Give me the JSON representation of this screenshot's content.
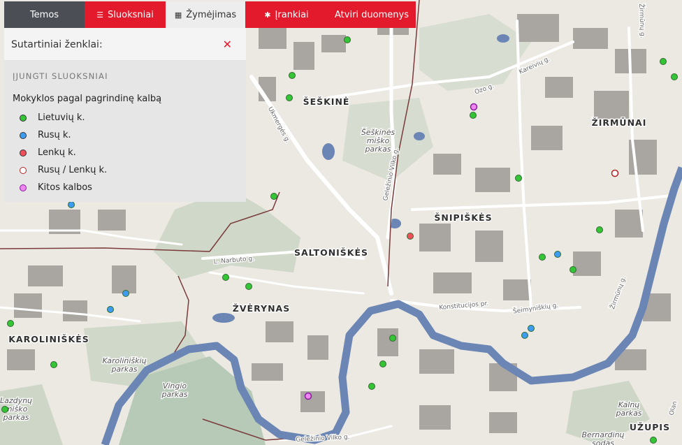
{
  "tabs": [
    {
      "label": "Temos",
      "icon": "",
      "active": false
    },
    {
      "label": "Sluoksniai",
      "icon": "list-icon",
      "active": false
    },
    {
      "label": "Žymėjimas",
      "icon": "grid-icon",
      "active": true
    },
    {
      "label": "Įrankiai",
      "icon": "gear-icon",
      "active": false
    },
    {
      "label": "Atviri duomenys",
      "icon": "",
      "active": false
    }
  ],
  "panel": {
    "title": "Sutartiniai ženklai:",
    "section": "ĮJUNGTI SLUOKSNIAI",
    "group": "Mokyklos pagal pagrindinę kalbą",
    "legend": [
      {
        "label": "Lietuvių k.",
        "color": "#35c435",
        "ring": false
      },
      {
        "label": "Rusų k.",
        "color": "#3d9cf0",
        "ring": false
      },
      {
        "label": "Lenkų k.",
        "color": "#f0505a",
        "ring": false
      },
      {
        "label": "Rusų / Lenkų k.",
        "color": "#ffffff",
        "ring": true,
        "ring_color": "#b22222"
      },
      {
        "label": "Kitos kalbos",
        "color": "#ee88f0",
        "ring": true,
        "ring_color": "#8a1aa0"
      }
    ]
  },
  "map": {
    "colors": {
      "background": "#ece9e3",
      "river": "#6b86b4",
      "green": "#cfd8c9",
      "park": "#b7cab8",
      "building": "#a9a6a2",
      "road": "#ffffff",
      "rail": "#7a3a3a"
    },
    "labels": [
      {
        "text": "ŠEŠKINĖ",
        "kind": "district"
      },
      {
        "text": "ŽIRMŪNAI",
        "kind": "district"
      },
      {
        "text": "ŠNIPIŠKĖS",
        "kind": "district"
      },
      {
        "text": "SALTONIŠKĖS",
        "kind": "district"
      },
      {
        "text": "ŽVĖRYNAS",
        "kind": "district"
      },
      {
        "text": "KAROLINIŠKĖS",
        "kind": "district"
      },
      {
        "text": "UŽUPIS",
        "kind": "district"
      },
      {
        "text": "Šeškinės\nmiško\nparkas",
        "kind": "park"
      },
      {
        "text": "Karoliniškių\nparkas",
        "kind": "park"
      },
      {
        "text": "Vingio\nparkas",
        "kind": "park"
      },
      {
        "text": "Lazdynų\nmiško\nparkas",
        "kind": "park"
      },
      {
        "text": "Kalnų\nparkas",
        "kind": "park"
      },
      {
        "text": "Bernardinų\nsodas",
        "kind": "park"
      },
      {
        "text": "Ukmergės g.",
        "kind": "street"
      },
      {
        "text": "Geležinio Vilko g.",
        "kind": "street"
      },
      {
        "text": "Ozo g.",
        "kind": "street"
      },
      {
        "text": "Kareivių g.",
        "kind": "street"
      },
      {
        "text": "Žirmūnų g.",
        "kind": "street"
      },
      {
        "text": "L. Narbuto g.",
        "kind": "street"
      },
      {
        "text": "Konstitucijos pr.",
        "kind": "street"
      },
      {
        "text": "Geležinio Vilko g.",
        "kind": "street"
      },
      {
        "text": "Šeimyniškių g.",
        "kind": "street"
      },
      {
        "text": "Žirmūnų g.",
        "kind": "street"
      },
      {
        "text": "Olan",
        "kind": "street"
      }
    ],
    "schools": [
      {
        "lang": 0
      },
      {
        "lang": 0
      },
      {
        "lang": 0
      },
      {
        "lang": 4
      },
      {
        "lang": 0
      },
      {
        "lang": 0
      },
      {
        "lang": 1
      },
      {
        "lang": 0
      },
      {
        "lang": 0
      },
      {
        "lang": 0
      },
      {
        "lang": 0
      },
      {
        "lang": 3
      },
      {
        "lang": 2
      },
      {
        "lang": 0
      },
      {
        "lang": 1
      },
      {
        "lang": 0
      },
      {
        "lang": 0
      },
      {
        "lang": 1
      },
      {
        "lang": 1
      },
      {
        "lang": 1
      },
      {
        "lang": 0
      },
      {
        "lang": 0
      },
      {
        "lang": 0
      },
      {
        "lang": 0
      },
      {
        "lang": 4
      },
      {
        "lang": 0
      },
      {
        "lang": 0
      },
      {
        "lang": 0
      },
      {
        "lang": 0
      },
      {
        "lang": 1
      }
    ]
  }
}
